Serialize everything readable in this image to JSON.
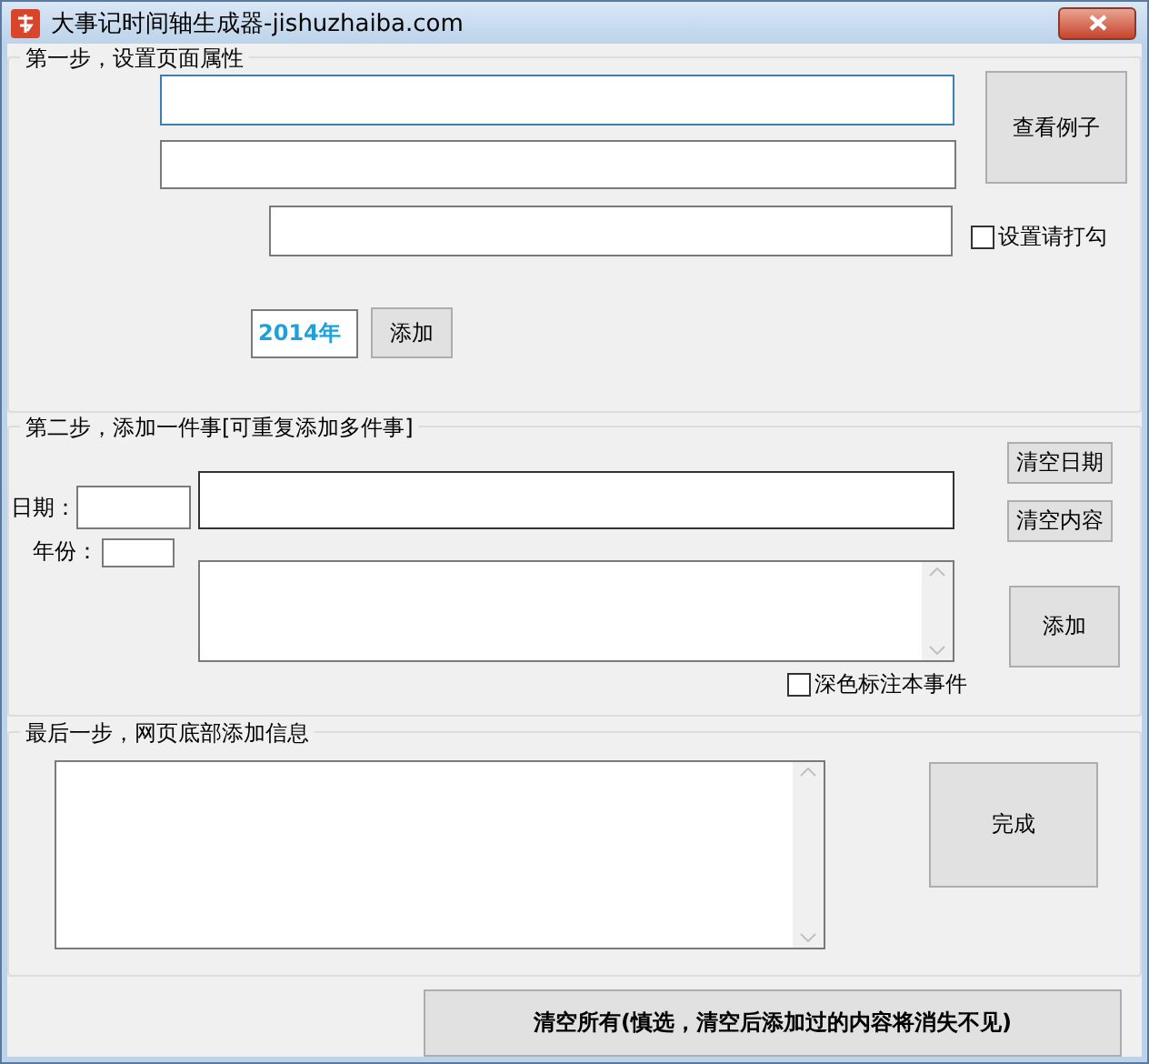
{
  "window": {
    "title": "大事记时间轴生成器-jishuzhaiba.com"
  },
  "step1": {
    "legend": "第一步，设置页面属性",
    "fields": [
      {
        "focused": true
      },
      {
        "focused": false
      },
      {
        "focused": false
      }
    ],
    "example_button": "查看例子",
    "checkbox": {
      "label": "设置请打勾",
      "checked": false
    },
    "year_field": {
      "value": "2014年"
    },
    "add_button": "添加"
  },
  "step2": {
    "legend": "第二步，添加一件事[可重复添加多件事]",
    "date_label": "日期：",
    "year_label": "年份：",
    "clear_date_button": "清空日期",
    "clear_content_button": "清空内容",
    "add_button": "添加",
    "checkbox": {
      "label": "深色标注本事件",
      "checked": false
    }
  },
  "step3": {
    "legend": "最后一步，网页底部添加信息",
    "done_button": "完成"
  },
  "clear_all_button": "清空所有(慎选，清空后添加过的内容将消失不见)"
}
